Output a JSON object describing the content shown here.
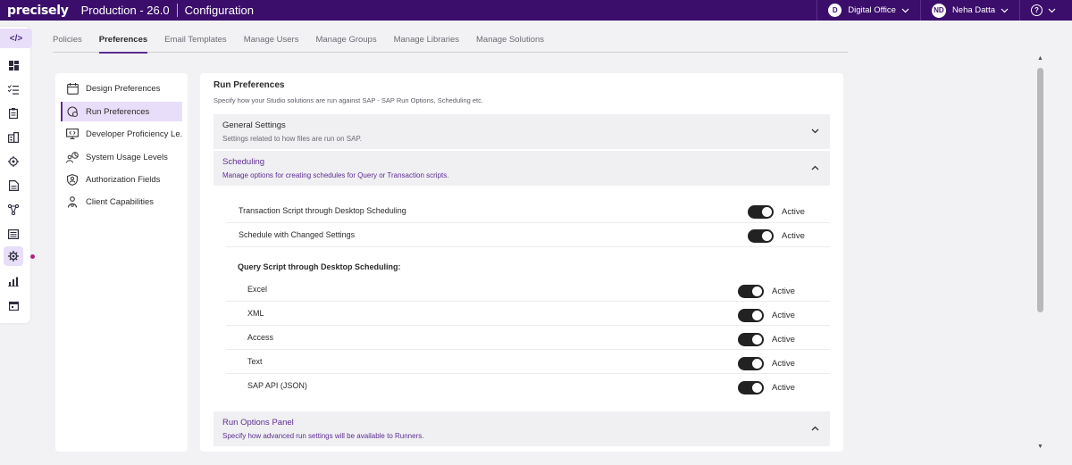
{
  "app": {
    "logo": "precisely",
    "environment": "Production - 26.0",
    "module": "Configuration"
  },
  "header": {
    "org_initial": "D",
    "org_name": "Digital Office",
    "user_initials": "ND",
    "user_name": "Neha Datta",
    "help_glyph": "?"
  },
  "rail": {
    "toggle_glyph": "</>",
    "icons": [
      "dashboard-icon",
      "checklist-icon",
      "clipboard-icon",
      "building-icon",
      "bug-icon",
      "document-icon",
      "workflow-icon",
      "list-icon",
      "gear-icon",
      "chart-icon",
      "calendar-icon"
    ],
    "active_icon": "gear-icon"
  },
  "tabs": [
    {
      "label": "Policies",
      "active": false
    },
    {
      "label": "Preferences",
      "active": true
    },
    {
      "label": "Email Templates",
      "active": false
    },
    {
      "label": "Manage Users",
      "active": false
    },
    {
      "label": "Manage Groups",
      "active": false
    },
    {
      "label": "Manage Libraries",
      "active": false
    },
    {
      "label": "Manage Solutions",
      "active": false
    }
  ],
  "sidenav": [
    {
      "label": "Design Preferences",
      "icon": "calendar-icon",
      "active": false
    },
    {
      "label": "Run Preferences",
      "icon": "run-gear-icon",
      "active": true
    },
    {
      "label": "Developer Proficiency Le...",
      "icon": "monitor-code-icon",
      "active": false
    },
    {
      "label": "System Usage Levels",
      "icon": "people-chart-icon",
      "active": false
    },
    {
      "label": "Authorization Fields",
      "icon": "shield-user-icon",
      "active": false
    },
    {
      "label": "Client Capabilities",
      "icon": "person-gear-icon",
      "active": false
    }
  ],
  "main": {
    "title": "Run Preferences",
    "subtitle": "Specify how your Studio solutions are run against SAP - SAP Run Options, Scheduling etc.",
    "general": {
      "title": "General Settings",
      "desc": "Settings related to how files are run on SAP.",
      "expanded": false
    },
    "scheduling": {
      "title": "Scheduling",
      "desc": "Manage options for creating schedules for Query or Transaction scripts.",
      "expanded": true,
      "settings": [
        {
          "label": "Transaction Script through Desktop Scheduling",
          "status": "Active",
          "on": true
        },
        {
          "label": "Schedule with Changed Settings",
          "status": "Active",
          "on": true
        }
      ],
      "query_heading": "Query Script through Desktop Scheduling:",
      "query_settings": [
        {
          "label": "Excel",
          "status": "Active",
          "on": true
        },
        {
          "label": "XML",
          "status": "Active",
          "on": true
        },
        {
          "label": "Access",
          "status": "Active",
          "on": true
        },
        {
          "label": "Text",
          "status": "Active",
          "on": true
        },
        {
          "label": "SAP API (JSON)",
          "status": "Active",
          "on": true
        }
      ]
    },
    "run_options": {
      "title": "Run Options Panel",
      "desc": "Specify how advanced run settings will be available to Runners.",
      "expanded": true
    }
  },
  "colors": {
    "brand": "#3b0e6b",
    "accent": "#5d2d91",
    "highlight": "#e9def9",
    "toggle_on": "#222222"
  }
}
